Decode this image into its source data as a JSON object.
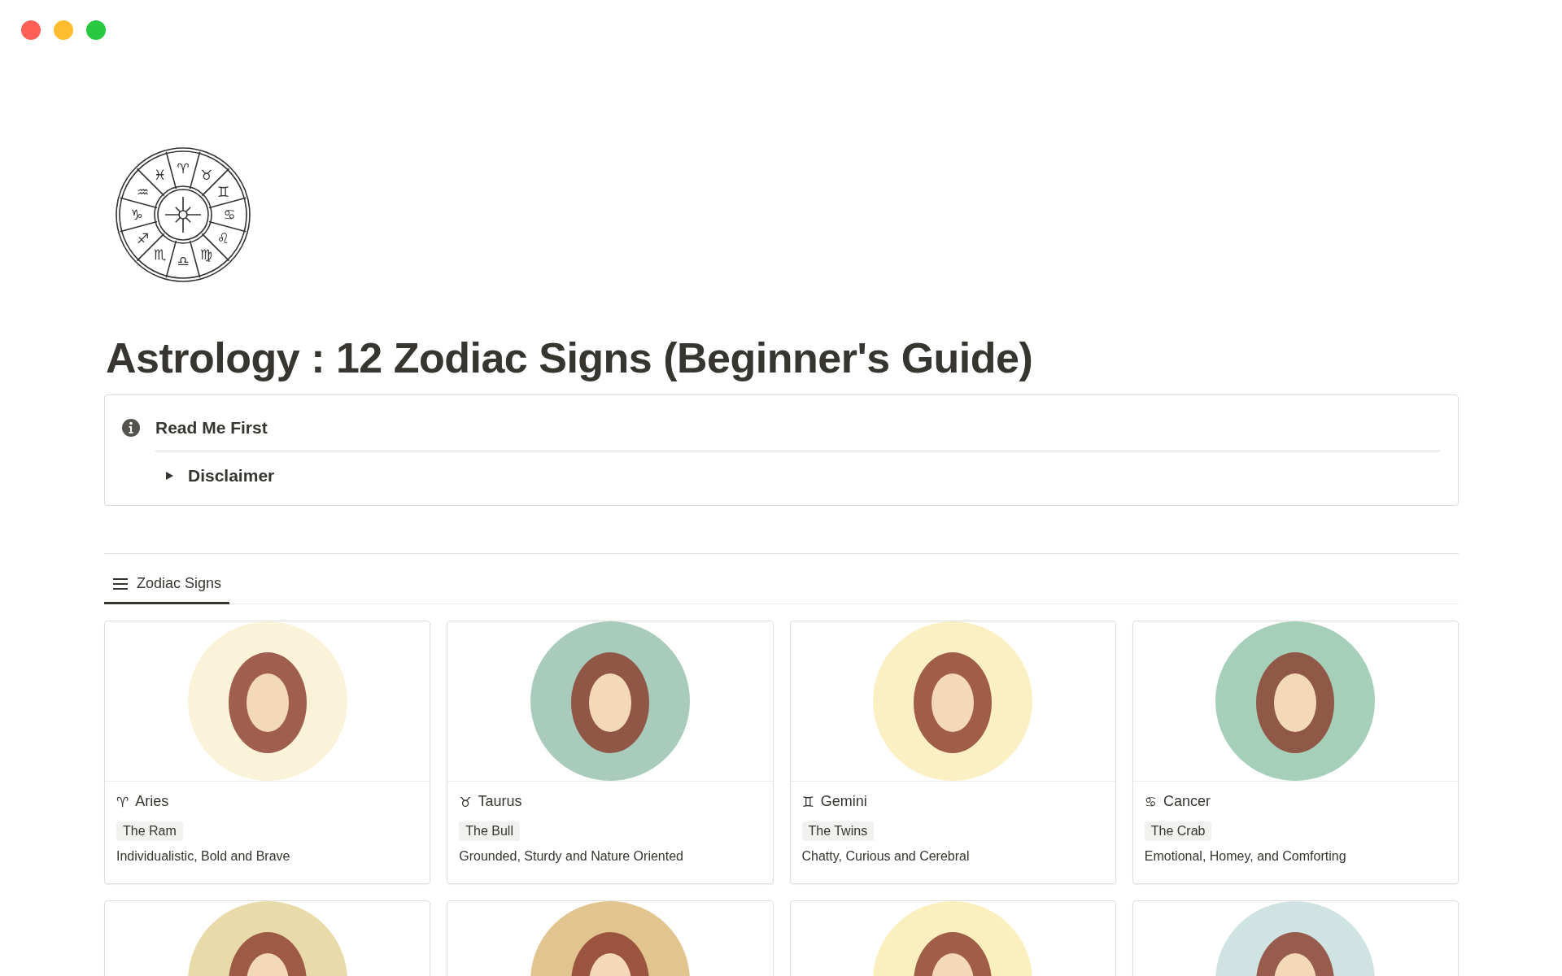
{
  "window": {
    "controls": [
      {
        "color": "#fe5f57"
      },
      {
        "color": "#febc2e"
      },
      {
        "color": "#28c840"
      }
    ]
  },
  "page_icon": {
    "symbols": [
      "♈",
      "♓",
      "♉",
      "♒",
      "♊",
      "♑",
      "♋",
      "♐",
      "♌",
      "♏",
      "♍",
      "♎"
    ]
  },
  "title": "Astrology : 12 Zodiac Signs (Beginner's Guide)",
  "callout": {
    "title": "Read Me First",
    "toggle": {
      "label": "Disclaimer",
      "expanded": false
    }
  },
  "tabs": [
    {
      "label": "Zodiac Signs",
      "selected": true
    }
  ],
  "cards": [
    {
      "symbol": "♈",
      "name": "Aries",
      "tag": "The Ram",
      "description": "Individualistic, Bold and Brave",
      "color": "#fbf3d9"
    },
    {
      "symbol": "♉",
      "name": "Taurus",
      "tag": "The Bull",
      "description": "Grounded, Sturdy and Nature Oriented",
      "color": "#a9cbbb"
    },
    {
      "symbol": "♊",
      "name": "Gemini",
      "tag": "The Twins",
      "description": "Chatty, Curious and Cerebral",
      "color": "#fbf0c4"
    },
    {
      "symbol": "♋",
      "name": "Cancer",
      "tag": "The Crab",
      "description": "Emotional, Homey, and Comforting",
      "color": "#a6cfb9"
    },
    {
      "color": "#e9dba9"
    },
    {
      "color": "#e2c48f"
    },
    {
      "color": "#fbefbe"
    },
    {
      "color": "#cfe4e2"
    }
  ]
}
